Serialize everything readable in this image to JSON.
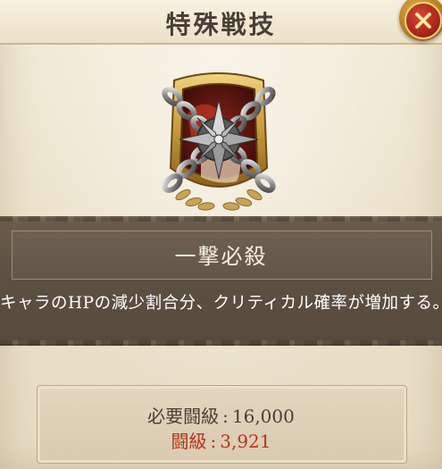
{
  "window": {
    "title": "特殊戦技"
  },
  "close_button": {
    "icon": "close-x-icon",
    "colors": {
      "outer": "#c48a2a",
      "inner": "#b42a1c",
      "mark": "#f4d77a"
    }
  },
  "emblem": {
    "icon": "chained-compass-star-emblem",
    "colors": {
      "frame": "#c79a3a",
      "chain": "#5c5c5c",
      "star": "#8a8a8a",
      "laurel": "#b8924a"
    }
  },
  "skill": {
    "name": "一撃必殺",
    "description": "キャラのHPの減少割合分、クリティカル確率が増加する。"
  },
  "requirements": {
    "required_label": "必要闘級",
    "required_value": "16,000",
    "current_label": "闘級",
    "current_value": "3,921",
    "separator": ":",
    "current_color": "#b5331b"
  }
}
